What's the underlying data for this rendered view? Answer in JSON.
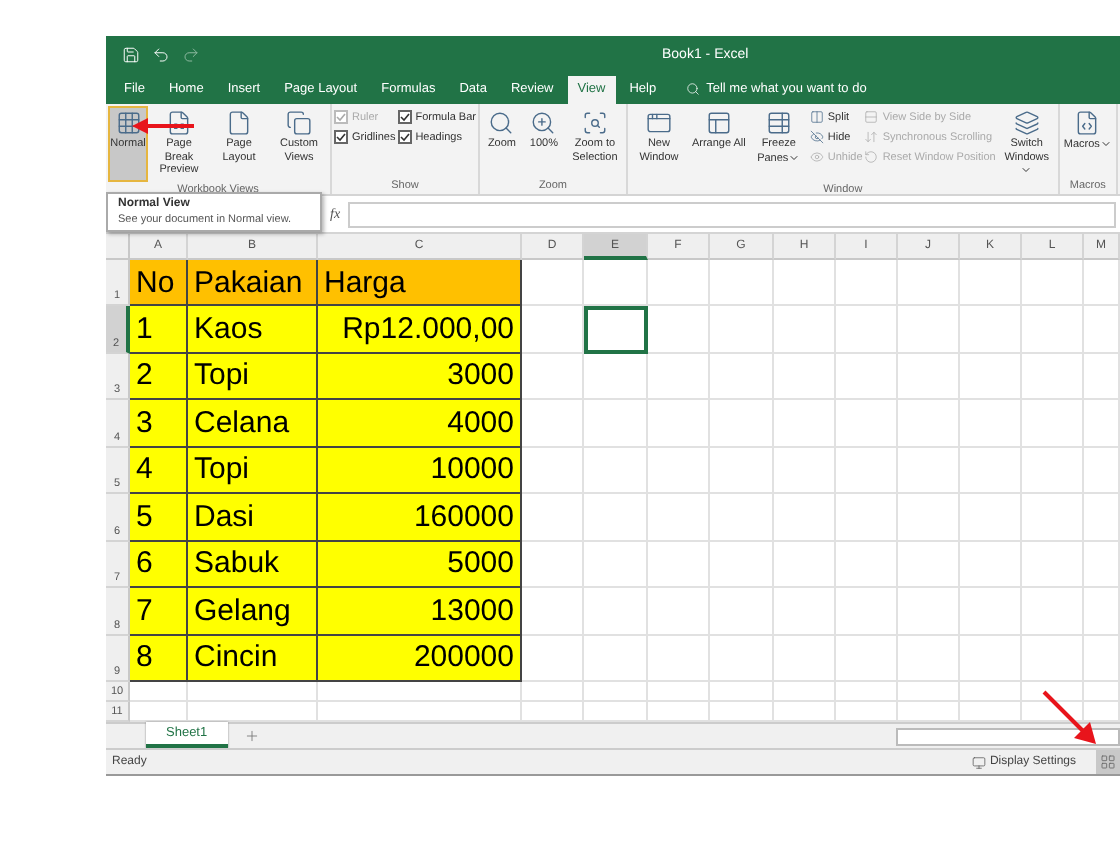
{
  "title_bar": {
    "title": "Book1 - Excel"
  },
  "ribbon_tabs": [
    {
      "label": "File",
      "selected": false
    },
    {
      "label": "Home",
      "selected": false
    },
    {
      "label": "Insert",
      "selected": false
    },
    {
      "label": "Page Layout",
      "selected": false
    },
    {
      "label": "Formulas",
      "selected": false
    },
    {
      "label": "Data",
      "selected": false
    },
    {
      "label": "Review",
      "selected": false
    },
    {
      "label": "View",
      "selected": true
    },
    {
      "label": "Help",
      "selected": false
    }
  ],
  "tell_me": {
    "placeholder": "Tell me what you want to do"
  },
  "ribbon": {
    "groups": [
      {
        "label": "Workbook Views",
        "items": [
          {
            "kind": "large",
            "label": "Normal",
            "selected": true,
            "dropdown": false,
            "disabled": false
          },
          {
            "kind": "large",
            "label": "Page Break Preview",
            "selected": false,
            "dropdown": false,
            "disabled": false
          },
          {
            "kind": "large",
            "label": "Page Layout",
            "selected": false,
            "dropdown": false,
            "disabled": false
          },
          {
            "kind": "large",
            "label": "Custom Views",
            "selected": false,
            "dropdown": false,
            "disabled": false
          }
        ]
      },
      {
        "label": "Show",
        "items": [
          {
            "kind": "stack",
            "items": [
              {
                "kind": "checkbox",
                "label": "Ruler",
                "checked": true,
                "disabled": true
              },
              {
                "kind": "checkbox",
                "label": "Gridlines",
                "checked": true,
                "disabled": false
              }
            ]
          },
          {
            "kind": "stack",
            "items": [
              {
                "kind": "checkbox",
                "label": "Formula Bar",
                "checked": true,
                "disabled": false
              },
              {
                "kind": "checkbox",
                "label": "Headings",
                "checked": true,
                "disabled": false
              }
            ]
          }
        ]
      },
      {
        "label": "Zoom",
        "items": [
          {
            "kind": "large",
            "label": "Zoom",
            "selected": false,
            "dropdown": false,
            "disabled": false
          },
          {
            "kind": "large",
            "label": "100%",
            "selected": false,
            "dropdown": false,
            "disabled": false
          },
          {
            "kind": "large",
            "label": "Zoom to Selection",
            "selected": false,
            "dropdown": false,
            "disabled": false
          }
        ]
      },
      {
        "label": "Window",
        "items": [
          {
            "kind": "large",
            "label": "New Window",
            "selected": false,
            "dropdown": false,
            "disabled": false
          },
          {
            "kind": "large",
            "label": "Arrange All",
            "selected": false,
            "dropdown": false,
            "disabled": false
          },
          {
            "kind": "large",
            "label": "Freeze Panes",
            "selected": false,
            "dropdown": true,
            "disabled": false
          },
          {
            "kind": "stack",
            "items": [
              {
                "kind": "small",
                "label": "Split",
                "disabled": false
              },
              {
                "kind": "small",
                "label": "Hide",
                "disabled": false
              },
              {
                "kind": "small",
                "label": "Unhide",
                "disabled": true
              }
            ]
          },
          {
            "kind": "stack",
            "items": [
              {
                "kind": "small",
                "label": "View Side by Side",
                "disabled": true
              },
              {
                "kind": "small",
                "label": "Synchronous Scrolling",
                "disabled": true
              },
              {
                "kind": "small",
                "label": "Reset Window Position",
                "disabled": true
              }
            ]
          },
          {
            "kind": "large",
            "label": "Switch Windows",
            "selected": false,
            "dropdown": true,
            "disabled": false
          }
        ]
      },
      {
        "label": "Macros",
        "items": [
          {
            "kind": "large",
            "label": "Macros",
            "selected": false,
            "dropdown": true,
            "disabled": false
          }
        ]
      }
    ]
  },
  "tooltip": {
    "title": "Normal View",
    "text": "See your document in Normal view."
  },
  "formula_bar": {
    "function_label": "fx"
  },
  "grid": {
    "columns": [
      {
        "label": "A",
        "selected": false
      },
      {
        "label": "B",
        "selected": false
      },
      {
        "label": "C",
        "selected": false
      },
      {
        "label": "D",
        "selected": false
      },
      {
        "label": "E",
        "selected": true
      },
      {
        "label": "F",
        "selected": false
      },
      {
        "label": "G",
        "selected": false
      },
      {
        "label": "H",
        "selected": false
      },
      {
        "label": "I",
        "selected": false
      },
      {
        "label": "J",
        "selected": false
      },
      {
        "label": "K",
        "selected": false
      },
      {
        "label": "L",
        "selected": false
      },
      {
        "label": "M",
        "selected": false
      }
    ],
    "rows": [
      {
        "label": "1",
        "kind": "header",
        "selected": false,
        "cells": [
          "No",
          "Pakaian",
          "Harga"
        ]
      },
      {
        "label": "2",
        "kind": "data",
        "selected": true,
        "cells": [
          "1",
          "Kaos",
          "Rp12.000,00"
        ]
      },
      {
        "label": "3",
        "kind": "data",
        "selected": false,
        "cells": [
          "2",
          "Topi",
          "3000"
        ]
      },
      {
        "label": "4",
        "kind": "data",
        "selected": false,
        "cells": [
          "3",
          "Celana",
          "4000"
        ]
      },
      {
        "label": "5",
        "kind": "data",
        "selected": false,
        "cells": [
          "4",
          "Topi",
          "10000"
        ]
      },
      {
        "label": "6",
        "kind": "data",
        "selected": false,
        "cells": [
          "5",
          "Dasi",
          "160000"
        ]
      },
      {
        "label": "7",
        "kind": "data",
        "selected": false,
        "cells": [
          "6",
          "Sabuk",
          "5000"
        ]
      },
      {
        "label": "8",
        "kind": "data",
        "selected": false,
        "cells": [
          "7",
          "Gelang",
          "13000"
        ]
      },
      {
        "label": "9",
        "kind": "data",
        "selected": false,
        "cells": [
          "8",
          "Cincin",
          "200000"
        ]
      },
      {
        "label": "10",
        "kind": "empty",
        "selected": false
      },
      {
        "label": "11",
        "kind": "empty",
        "selected": false
      }
    ]
  },
  "sheet_tabs": [
    {
      "label": "Sheet1",
      "selected": true
    }
  ],
  "status_bar": {
    "status": "Ready",
    "display_settings": "Display Settings"
  }
}
